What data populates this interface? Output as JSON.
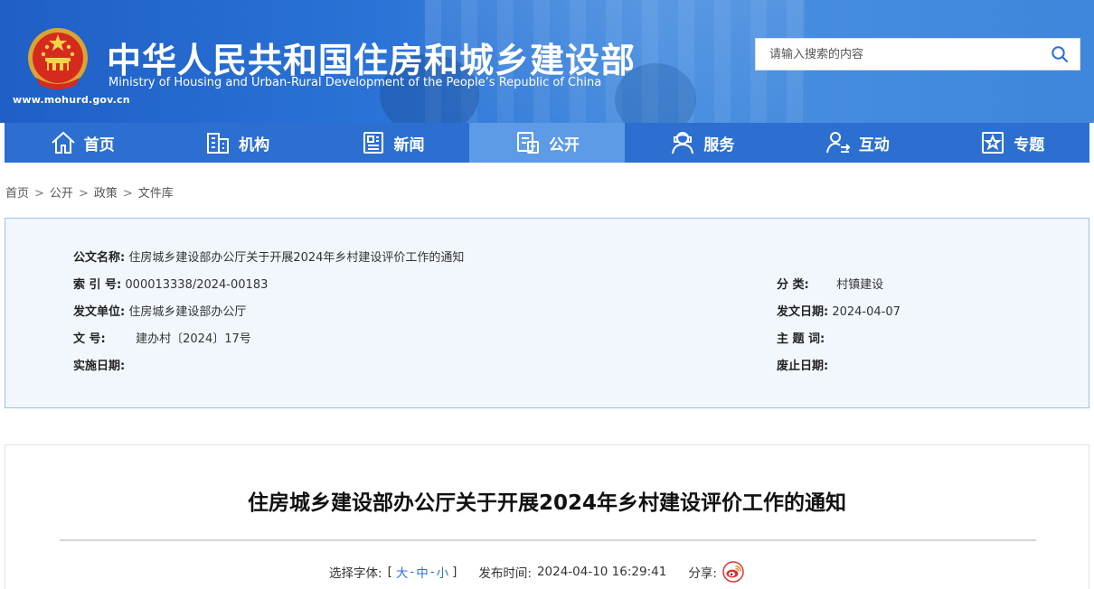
{
  "header": {
    "cn_title": "中华人民共和国住房和城乡建设部",
    "en_title": "Ministry of Housing and Urban-Rural Development of the People’s Republic of China",
    "site_url": "www.mohurd.gov.cn",
    "bg_color": "#2b73d6"
  },
  "search": {
    "placeholder": "请输入搜索的内容",
    "icon": "search-icon"
  },
  "nav": {
    "items": [
      {
        "label": "首页",
        "icon": "home-icon"
      },
      {
        "label": "机构",
        "icon": "building-icon"
      },
      {
        "label": "新闻",
        "icon": "newspaper-icon"
      },
      {
        "label": "公开",
        "icon": "document-icon",
        "active": true
      },
      {
        "label": "服务",
        "icon": "service-icon"
      },
      {
        "label": "互动",
        "icon": "interaction-icon"
      },
      {
        "label": "专题",
        "icon": "star-icon"
      }
    ],
    "bg_color": "#2c6fd1",
    "active_color": "#5e9be6"
  },
  "breadcrumb": [
    "首页",
    "公开",
    "政策",
    "文件库"
  ],
  "meta": {
    "title_label": "公文名称:",
    "title_value": "住房城乡建设部办公厅关于开展2024年乡村建设评价工作的通知",
    "index_label": "索 引 号:",
    "index_value": "000013338/2024-00183",
    "category_label": "分 类:",
    "category_value": "村镇建设",
    "issuer_label": "发文单位:",
    "issuer_value": "住房城乡建设部办公厅",
    "date_label": "发文日期:",
    "date_value": "2024-04-07",
    "docno_label": "文 号:",
    "docno_value": "建办村〔2024〕17号",
    "keywords_label": "主 题 词:",
    "keywords_value": "",
    "effective_label": "实施日期:",
    "effective_value": "",
    "expiry_label": "废止日期:",
    "expiry_value": ""
  },
  "article": {
    "title": "住房城乡建设部办公厅关于开展2024年乡村建设评价工作的通知",
    "font_label": "选择字体:",
    "font_open": "[",
    "font_large": "大",
    "font_medium": "中",
    "font_small": "小",
    "font_close": "]",
    "font_sep": "-",
    "publish_label": "发布时间:",
    "publish_time": "2024-04-10 16:29:41",
    "share_label": "分享:",
    "share_icon": "weibo-icon"
  }
}
